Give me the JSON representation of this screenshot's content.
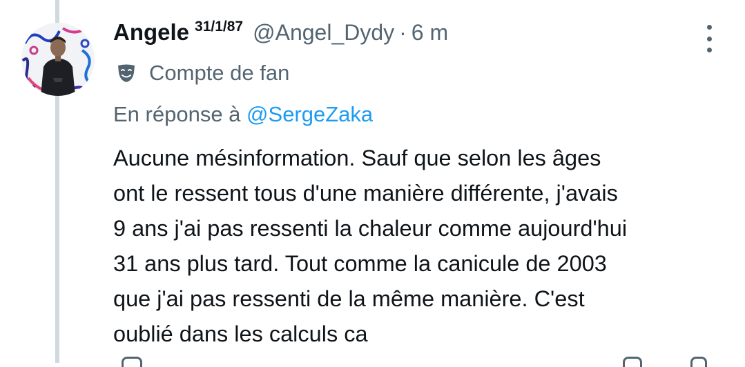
{
  "tweet": {
    "author": {
      "display_name": "Angele",
      "name_superscript": "31/1/87",
      "handle": "@Angel_Dydy",
      "separator": "·",
      "time": "6 m"
    },
    "account_label": {
      "icon": "theater-mask-icon",
      "text": "Compte de fan"
    },
    "reply_to": {
      "prefix": "En réponse à",
      "handle": "@SergeZaka"
    },
    "text_lines": [
      "Aucune mésinformation. Sauf que selon les âges",
      "ont le ressent tous d'une manière différente, j'avais",
      "9 ans j'ai pas ressenti la chaleur comme aujourd'hui",
      "31 ans plus tard. Tout comme la canicule de 2003",
      "que j'ai pas ressenti de la même manière. C'est",
      "oublié dans les calculs ca"
    ]
  },
  "colors": {
    "text_primary": "#0f1419",
    "text_secondary": "#536471",
    "link": "#1d9bf0",
    "thread_line": "#cfd9de"
  }
}
